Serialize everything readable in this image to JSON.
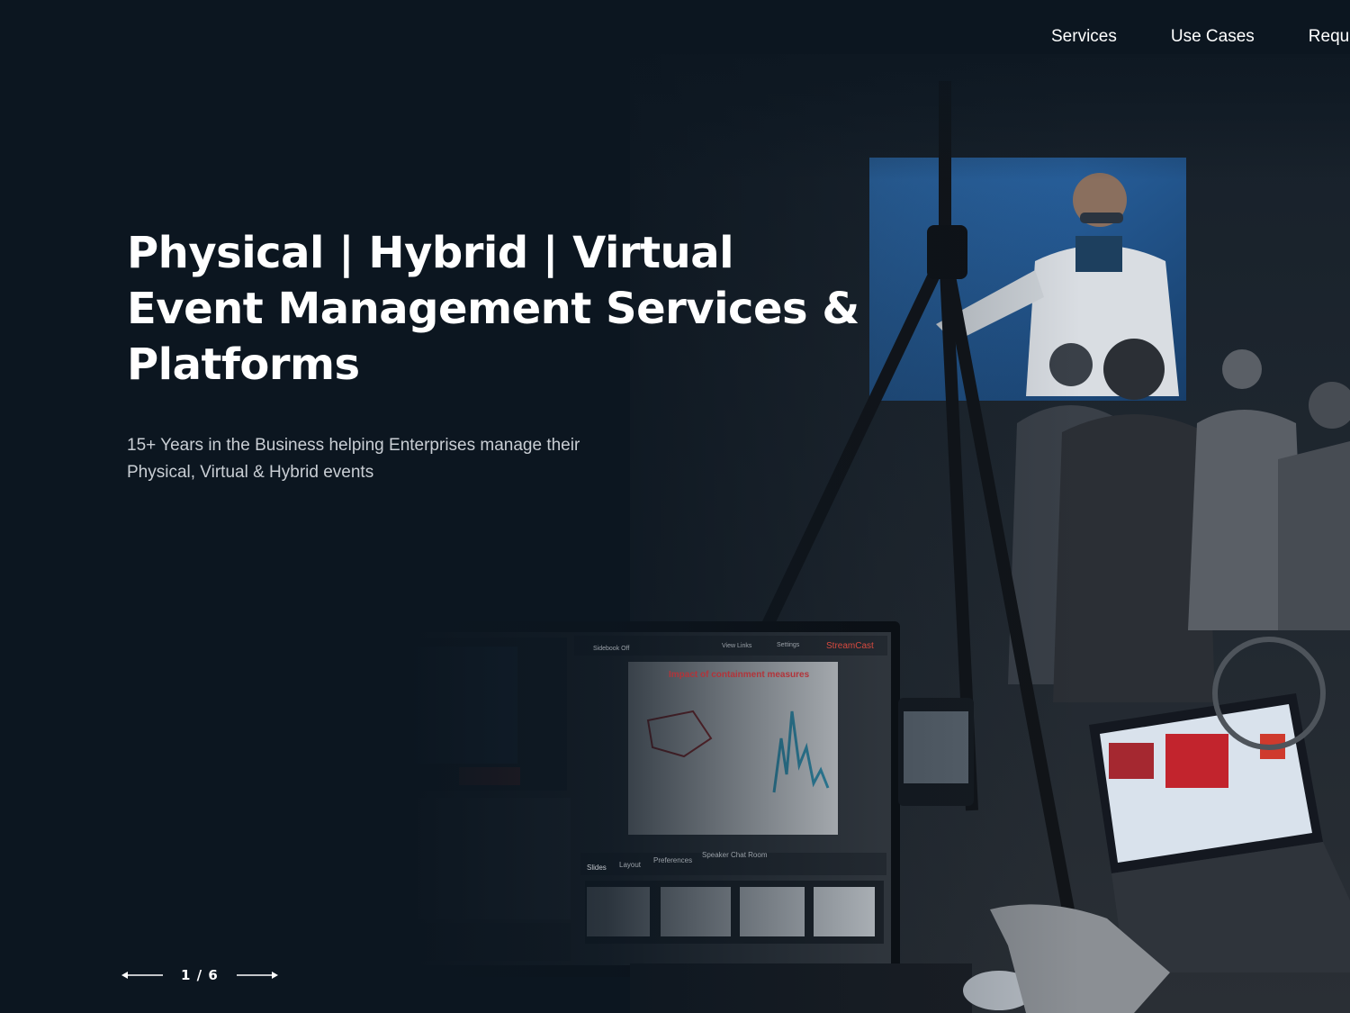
{
  "nav": {
    "items": [
      "Services",
      "Use Cases",
      "Requ"
    ]
  },
  "hero": {
    "headline_lines": [
      "Physical | Hybrid | Virtual",
      "Event Management Services &",
      "Platforms"
    ],
    "subtitle_lines": [
      "15+ Years in the Business helping Enterprises manage their",
      "Physical, Virtual & Hybrid events"
    ]
  },
  "screen": {
    "slide_title": "Impact of containment measures",
    "brand": "StreamCast",
    "toolbar": [
      "Sidebook Off",
      "View Links",
      "Settings"
    ],
    "tabs": [
      "Slides",
      "Layout",
      "Preferences",
      "Speaker Chat Room"
    ]
  },
  "slider": {
    "current": "1",
    "total": "6",
    "separator": "/"
  },
  "colors": {
    "background": "#0c1620",
    "text": "#ffffff",
    "subtitle": "#c9ced4",
    "projection": "#1f5ea0"
  }
}
